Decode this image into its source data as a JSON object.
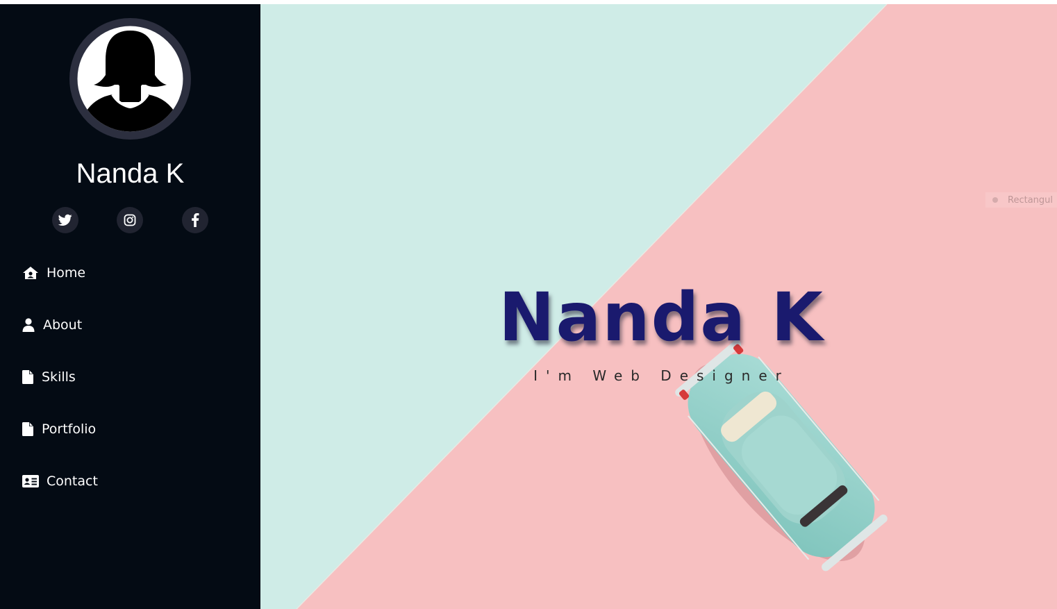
{
  "profile": {
    "name": "Nanda K"
  },
  "social": [
    {
      "icon": "twitter-icon"
    },
    {
      "icon": "instagram-icon"
    },
    {
      "icon": "facebook-icon"
    }
  ],
  "nav": [
    {
      "label": "Home",
      "icon": "home-icon"
    },
    {
      "label": "About",
      "icon": "user-icon"
    },
    {
      "label": "Skills",
      "icon": "file-icon"
    },
    {
      "label": "Portfolio",
      "icon": "file-icon"
    },
    {
      "label": "Contact",
      "icon": "address-card-icon"
    }
  ],
  "hero": {
    "title": "Nanda K",
    "subtitle": "I'm Web Designer",
    "overlay_label": "Rectangul"
  },
  "colors": {
    "sidebar_bg": "#040b14",
    "social_bg": "#212431",
    "hero_title": "#1a1a6e",
    "mint": "#cfece7",
    "pink": "#f7c0c1"
  }
}
